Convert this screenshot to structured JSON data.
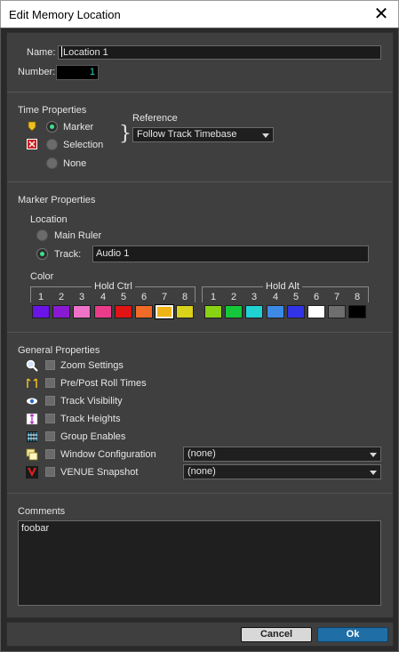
{
  "window": {
    "title": "Edit Memory Location",
    "close_glyph": "✕"
  },
  "name_label": "Name:",
  "name_value": "Location 1",
  "number_label": "Number:",
  "number_value": "1",
  "time_properties": {
    "title": "Time Properties",
    "options": [
      "Marker",
      "Selection",
      "None"
    ],
    "selected": "Marker",
    "reference_label": "Reference",
    "reference_value": "Follow Track Timebase"
  },
  "marker_properties": {
    "title": "Marker Properties",
    "location_label": "Location",
    "main_ruler_label": "Main Ruler",
    "track_label": "Track:",
    "track_value": "Audio 1",
    "selected": "Track",
    "color_label": "Color",
    "hold_ctrl_label": "Hold Ctrl",
    "hold_alt_label": "Hold Alt",
    "color_numbers": [
      "1",
      "2",
      "3",
      "4",
      "5",
      "6",
      "7",
      "8"
    ],
    "ctrl_colors": [
      "#6a14e6",
      "#8a1ad2",
      "#ee72c8",
      "#ea3c8a",
      "#e01414",
      "#f06a28",
      "#f0b414",
      "#d8d21a"
    ],
    "alt_colors": [
      "#8ad214",
      "#14c83a",
      "#20d2d2",
      "#3c8ae6",
      "#3232e6",
      "#ffffff",
      "#6e6e6e",
      "#000000"
    ],
    "selected_color": "7"
  },
  "general_properties": {
    "title": "General Properties",
    "items": [
      {
        "label": "Zoom Settings",
        "icon": "magnifier-icon"
      },
      {
        "label": "Pre/Post Roll Times",
        "icon": "preroll-icon"
      },
      {
        "label": "Track Visibility",
        "icon": "eye-icon"
      },
      {
        "label": "Track Heights",
        "icon": "track-heights-icon"
      },
      {
        "label": "Group Enables",
        "icon": "group-icon"
      },
      {
        "label": "Window Configuration",
        "icon": "window-config-icon"
      },
      {
        "label": "VENUE Snapshot",
        "icon": "venue-icon"
      }
    ],
    "window_config_value": "(none)",
    "venue_value": "(none)"
  },
  "comments": {
    "title": "Comments",
    "value": "foobar"
  },
  "buttons": {
    "cancel": "Cancel",
    "ok": "Ok"
  }
}
